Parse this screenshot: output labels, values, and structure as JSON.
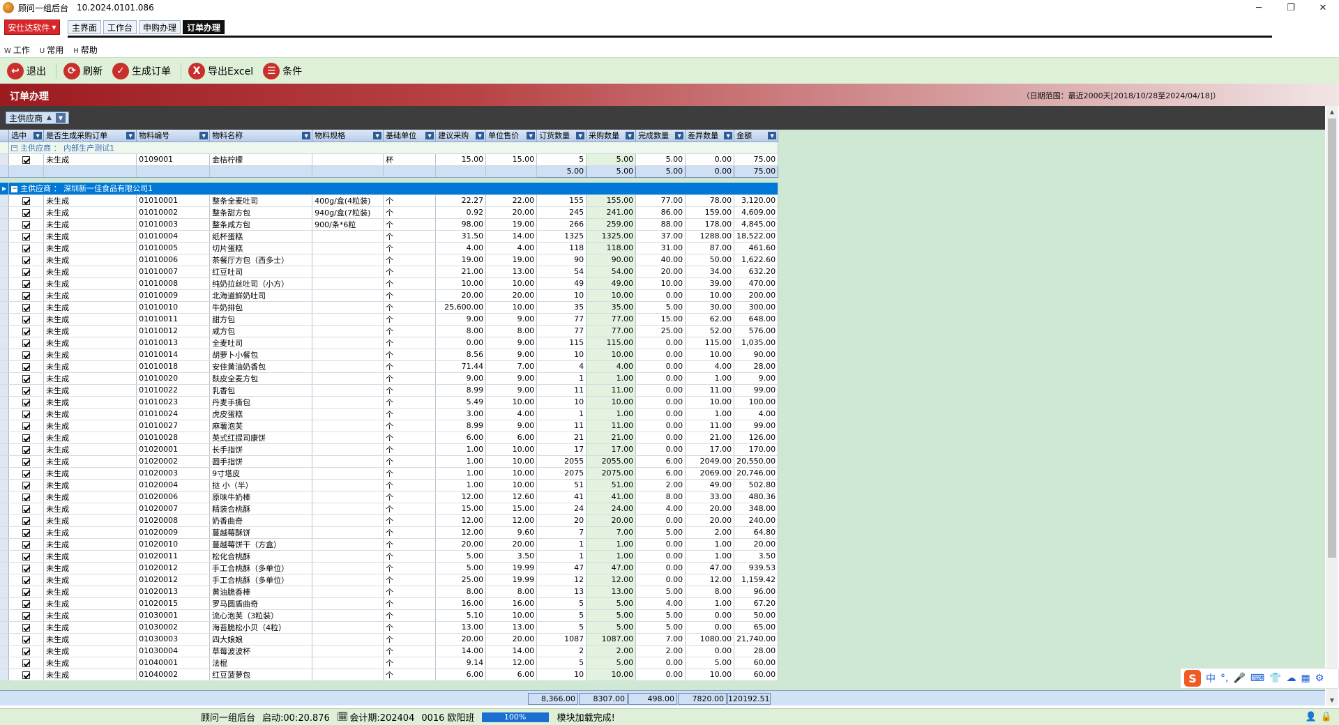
{
  "window": {
    "title": "顾问一组后台",
    "version": "10.2024.0101.086",
    "minimize": "─",
    "maximize": "❐",
    "close": "✕"
  },
  "company": {
    "label": "安仕达软件"
  },
  "tabs": [
    {
      "label": "主界面"
    },
    {
      "label": "工作台"
    },
    {
      "label": "申购办理"
    },
    {
      "label": "订单办理"
    }
  ],
  "menu": [
    {
      "key": "W",
      "label": "工作"
    },
    {
      "key": "U",
      "label": "常用"
    },
    {
      "key": "H",
      "label": "帮助"
    }
  ],
  "toolbar": [
    {
      "label": "退出",
      "icon": "exit-icon",
      "glyph": "↩"
    },
    {
      "label": "刷新",
      "icon": "refresh-icon",
      "glyph": "⟳"
    },
    {
      "label": "生成订单",
      "icon": "check-icon",
      "glyph": "✓"
    },
    {
      "label": "导出Excel",
      "icon": "excel-icon",
      "glyph": "X"
    },
    {
      "label": "条件",
      "icon": "filter-icon",
      "glyph": "☰"
    }
  ],
  "header": {
    "title": "订单办理",
    "range": "（日期范围：最近2000天[2018/10/28至2024/04/18]）"
  },
  "groupby": {
    "label": "主供应商"
  },
  "columns": [
    "选中",
    "是否生成采购订单",
    "物料编号",
    "物料名称",
    "物料规格",
    "基础单位",
    "建议采购",
    "单位售价",
    "订货数量",
    "采购数量",
    "完成数量",
    "差异数量",
    "金额"
  ],
  "group1": {
    "label": "主供应商 ： 内部生产测试1",
    "rows": [
      [
        "未生成",
        "0109001",
        "金桔柠檬",
        "",
        "杯",
        "15.00",
        "15.00",
        "5",
        "5.00",
        "5.00",
        "0.00",
        "75.00"
      ]
    ],
    "sum": [
      "5.00",
      "5.00",
      "5.00",
      "0.00",
      "75.00"
    ]
  },
  "group2": {
    "label": "主供应商 ： 深圳新一佳食品有限公司1",
    "rows": [
      [
        "未生成",
        "01010001",
        "整条全麦吐司",
        "400g/盒(4粒装)",
        "个",
        "22.27",
        "22.00",
        "155",
        "155.00",
        "77.00",
        "78.00",
        "3,120.00"
      ],
      [
        "未生成",
        "01010002",
        "整条甜方包",
        "940g/盒(7粒装)",
        "个",
        "0.92",
        "20.00",
        "245",
        "241.00",
        "86.00",
        "159.00",
        "4,609.00"
      ],
      [
        "未生成",
        "01010003",
        "整条咸方包",
        "900/条*6粒",
        "个",
        "98.00",
        "19.00",
        "266",
        "259.00",
        "88.00",
        "178.00",
        "4,845.00"
      ],
      [
        "未生成",
        "01010004",
        "纸杯蛋糕",
        "",
        "个",
        "31.50",
        "14.00",
        "1325",
        "1325.00",
        "37.00",
        "1288.00",
        "18,522.00"
      ],
      [
        "未生成",
        "01010005",
        "切片蛋糕",
        "",
        "个",
        "4.00",
        "4.00",
        "118",
        "118.00",
        "31.00",
        "87.00",
        "461.60"
      ],
      [
        "未生成",
        "01010006",
        "茶餐厅方包（西多士）",
        "",
        "个",
        "19.00",
        "19.00",
        "90",
        "90.00",
        "40.00",
        "50.00",
        "1,622.60"
      ],
      [
        "未生成",
        "01010007",
        "红豆吐司",
        "",
        "个",
        "21.00",
        "13.00",
        "54",
        "54.00",
        "20.00",
        "34.00",
        "632.20"
      ],
      [
        "未生成",
        "01010008",
        "纯奶拉丝吐司（小方）",
        "",
        "个",
        "10.00",
        "10.00",
        "49",
        "49.00",
        "10.00",
        "39.00",
        "470.00"
      ],
      [
        "未生成",
        "01010009",
        "北海道鲜奶吐司",
        "",
        "个",
        "20.00",
        "20.00",
        "10",
        "10.00",
        "0.00",
        "10.00",
        "200.00"
      ],
      [
        "未生成",
        "01010010",
        "牛奶排包",
        "",
        "个",
        "25,600.00",
        "10.00",
        "35",
        "35.00",
        "5.00",
        "30.00",
        "300.00"
      ],
      [
        "未生成",
        "01010011",
        "甜方包",
        "",
        "个",
        "9.00",
        "9.00",
        "77",
        "77.00",
        "15.00",
        "62.00",
        "648.00"
      ],
      [
        "未生成",
        "01010012",
        "咸方包",
        "",
        "个",
        "8.00",
        "8.00",
        "77",
        "77.00",
        "25.00",
        "52.00",
        "576.00"
      ],
      [
        "未生成",
        "01010013",
        "全麦吐司",
        "",
        "个",
        "0.00",
        "9.00",
        "115",
        "115.00",
        "0.00",
        "115.00",
        "1,035.00"
      ],
      [
        "未生成",
        "01010014",
        "胡萝卜小餐包",
        "",
        "个",
        "8.56",
        "9.00",
        "10",
        "10.00",
        "0.00",
        "10.00",
        "90.00"
      ],
      [
        "未生成",
        "01010018",
        "安佳黄油奶香包",
        "",
        "个",
        "71.44",
        "7.00",
        "4",
        "4.00",
        "0.00",
        "4.00",
        "28.00"
      ],
      [
        "未生成",
        "01010020",
        "麸皮全麦方包",
        "",
        "个",
        "9.00",
        "9.00",
        "1",
        "1.00",
        "0.00",
        "1.00",
        "9.00"
      ],
      [
        "未生成",
        "01010022",
        "乳香包",
        "",
        "个",
        "8.99",
        "9.00",
        "11",
        "11.00",
        "0.00",
        "11.00",
        "99.00"
      ],
      [
        "未生成",
        "01010023",
        "丹麦手撕包",
        "",
        "个",
        "5.49",
        "10.00",
        "10",
        "10.00",
        "0.00",
        "10.00",
        "100.00"
      ],
      [
        "未生成",
        "01010024",
        "虎皮蛋糕",
        "",
        "个",
        "3.00",
        "4.00",
        "1",
        "1.00",
        "0.00",
        "1.00",
        "4.00"
      ],
      [
        "未生成",
        "01010027",
        "麻薯泡芙",
        "",
        "个",
        "8.99",
        "9.00",
        "11",
        "11.00",
        "0.00",
        "11.00",
        "99.00"
      ],
      [
        "未生成",
        "01010028",
        "英式红提司康饼",
        "",
        "个",
        "6.00",
        "6.00",
        "21",
        "21.00",
        "0.00",
        "21.00",
        "126.00"
      ],
      [
        "未生成",
        "01020001",
        "长手指饼",
        "",
        "个",
        "1.00",
        "10.00",
        "17",
        "17.00",
        "0.00",
        "17.00",
        "170.00"
      ],
      [
        "未生成",
        "01020002",
        "圆手指饼",
        "",
        "个",
        "1.00",
        "10.00",
        "2055",
        "2055.00",
        "6.00",
        "2049.00",
        "20,550.00"
      ],
      [
        "未生成",
        "01020003",
        "9寸塔皮",
        "",
        "个",
        "1.00",
        "10.00",
        "2075",
        "2075.00",
        "6.00",
        "2069.00",
        "20,746.00"
      ],
      [
        "未生成",
        "01020004",
        "挞 小（半）",
        "",
        "个",
        "1.00",
        "10.00",
        "51",
        "51.00",
        "2.00",
        "49.00",
        "502.80"
      ],
      [
        "未生成",
        "01020006",
        "原味牛奶棒",
        "",
        "个",
        "12.00",
        "12.60",
        "41",
        "41.00",
        "8.00",
        "33.00",
        "480.36"
      ],
      [
        "未生成",
        "01020007",
        "精装合桃酥",
        "",
        "个",
        "15.00",
        "15.00",
        "24",
        "24.00",
        "4.00",
        "20.00",
        "348.00"
      ],
      [
        "未生成",
        "01020008",
        "奶香曲奇",
        "",
        "个",
        "12.00",
        "12.00",
        "20",
        "20.00",
        "0.00",
        "20.00",
        "240.00"
      ],
      [
        "未生成",
        "01020009",
        "蔓越莓酥饼",
        "",
        "个",
        "12.00",
        "9.60",
        "7",
        "7.00",
        "5.00",
        "2.00",
        "64.80"
      ],
      [
        "未生成",
        "01020010",
        "蔓越莓饼干（方盒）",
        "",
        "个",
        "20.00",
        "20.00",
        "1",
        "1.00",
        "0.00",
        "1.00",
        "20.00"
      ],
      [
        "未生成",
        "01020011",
        "松化合桃酥",
        "",
        "个",
        "5.00",
        "3.50",
        "1",
        "1.00",
        "0.00",
        "1.00",
        "3.50"
      ],
      [
        "未生成",
        "01020012",
        "手工合桃酥（多单位）",
        "",
        "个",
        "5.00",
        "19.99",
        "47",
        "47.00",
        "0.00",
        "47.00",
        "939.53"
      ],
      [
        "未生成",
        "01020012",
        "手工合桃酥（多单位）",
        "",
        "个",
        "25.00",
        "19.99",
        "12",
        "12.00",
        "0.00",
        "12.00",
        "1,159.42"
      ],
      [
        "未生成",
        "01020013",
        "黄油脆香棒",
        "",
        "个",
        "8.00",
        "8.00",
        "13",
        "13.00",
        "5.00",
        "8.00",
        "96.00"
      ],
      [
        "未生成",
        "01020015",
        "罗马圆盾曲奇",
        "",
        "个",
        "16.00",
        "16.00",
        "5",
        "5.00",
        "4.00",
        "1.00",
        "67.20"
      ],
      [
        "未生成",
        "01030001",
        "流心泡芙（3粒装）",
        "",
        "个",
        "5.10",
        "10.00",
        "5",
        "5.00",
        "5.00",
        "0.00",
        "50.00"
      ],
      [
        "未生成",
        "01030002",
        "海苔脆松小贝（4粒）",
        "",
        "个",
        "13.00",
        "13.00",
        "5",
        "5.00",
        "5.00",
        "0.00",
        "65.00"
      ],
      [
        "未生成",
        "01030003",
        "四大娘娘",
        "",
        "个",
        "20.00",
        "20.00",
        "1087",
        "1087.00",
        "7.00",
        "1080.00",
        "21,740.00"
      ],
      [
        "未生成",
        "01030004",
        "草莓波波杯",
        "",
        "个",
        "14.00",
        "14.00",
        "2",
        "2.00",
        "2.00",
        "0.00",
        "28.00"
      ],
      [
        "未生成",
        "01040001",
        "法棍",
        "",
        "个",
        "9.14",
        "12.00",
        "5",
        "5.00",
        "0.00",
        "5.00",
        "60.00"
      ],
      [
        "未生成",
        "01040002",
        "红豆菠萝包",
        "",
        "个",
        "6.00",
        "6.00",
        "10",
        "10.00",
        "0.00",
        "10.00",
        "60.00"
      ]
    ]
  },
  "totals": [
    "8,366.00",
    "8307.00",
    "498.00",
    "7820.00",
    "120192.51"
  ],
  "ime": {
    "logo": "S",
    "items": [
      "中",
      "°,",
      "🎤",
      "⌨",
      "👕",
      "☁",
      "▦",
      "⚙"
    ]
  },
  "status": {
    "name": "顾问一组后台",
    "startup": "启动:00:20.876",
    "period": "会计期:202404",
    "user": "0016 欧阳班",
    "progress": "100%",
    "message": "模块加载完成!"
  }
}
